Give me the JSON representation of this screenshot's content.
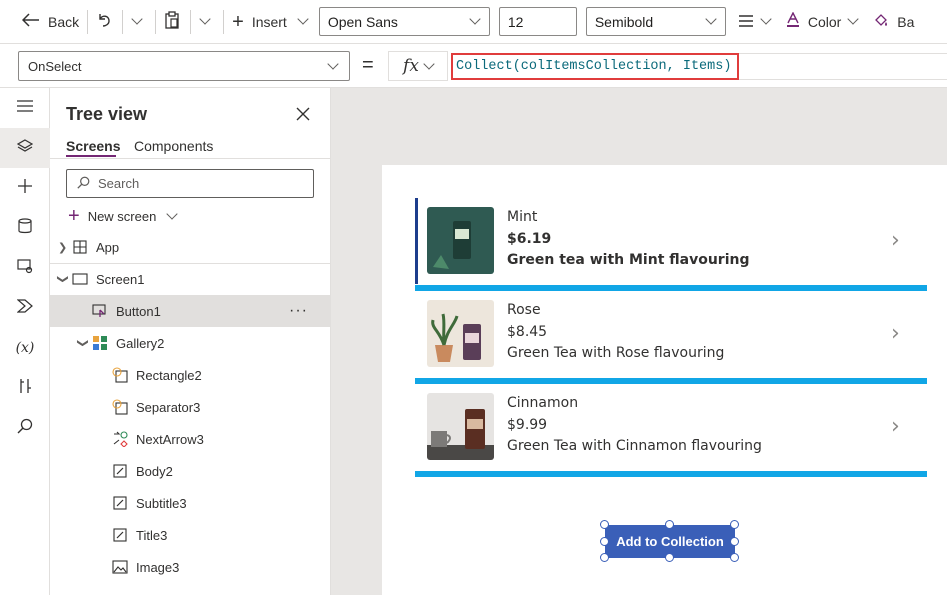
{
  "toolbar": {
    "back_label": "Back",
    "insert_label": "Insert",
    "font_value": "Open Sans",
    "size_value": "12",
    "weight_value": "Semibold",
    "color_label": "Color",
    "cut_label": "Ba"
  },
  "formula": {
    "property": "OnSelect",
    "equals": "=",
    "fx": "fx",
    "text": "Collect(colItemsCollection, Items)"
  },
  "tree": {
    "title": "Tree view",
    "tabs": [
      "Screens",
      "Components"
    ],
    "search_placeholder": "Search",
    "new_screen_label": "New screen",
    "nodes": [
      {
        "label": "App"
      },
      {
        "label": "Screen1"
      },
      {
        "label": "Button1"
      },
      {
        "label": "Gallery2"
      },
      {
        "label": "Rectangle2"
      },
      {
        "label": "Separator3"
      },
      {
        "label": "NextArrow3"
      },
      {
        "label": "Body2"
      },
      {
        "label": "Subtitle3"
      },
      {
        "label": "Title3"
      },
      {
        "label": "Image3"
      }
    ]
  },
  "gallery": {
    "items": [
      {
        "title": "Mint",
        "price": "$6.19",
        "description": "Green tea with Mint flavouring"
      },
      {
        "title": "Rose",
        "price": "$8.45",
        "description": "Green Tea with Rose flavouring"
      },
      {
        "title": "Cinnamon",
        "price": "$9.99",
        "description": "Green Tea with Cinnamon flavouring"
      }
    ]
  },
  "button": {
    "label": "Add to Collection"
  },
  "colors": {
    "accent_purple": "#742774",
    "gallery_separator": "#11a6e6",
    "button_bg": "#3a5fb8",
    "formula_highlight": "#e03c3c"
  }
}
